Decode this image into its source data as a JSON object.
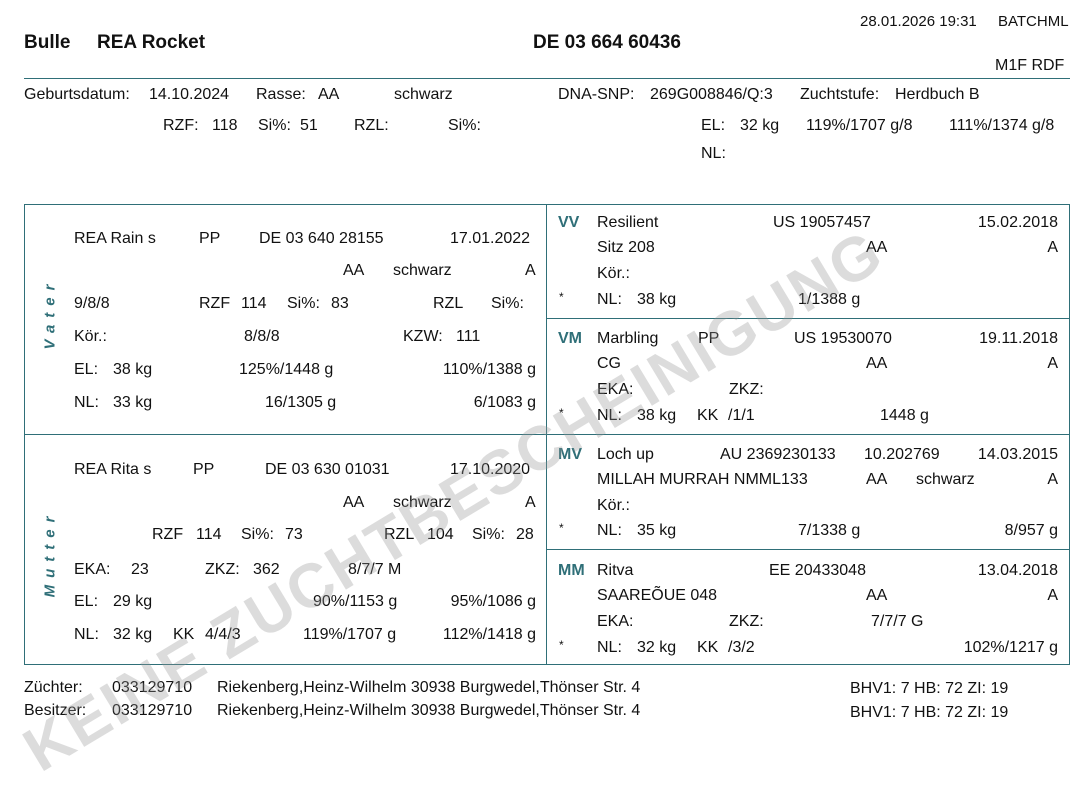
{
  "header": {
    "datetime": "28.01.2026 19:31",
    "user": "BATCHML",
    "sex": "Bulle",
    "name": "REA Rocket",
    "id": "DE 03 664 60436",
    "code": "M1F RDF"
  },
  "animal": {
    "birth_label": "Geburtsdatum:",
    "birth": "14.10.2024",
    "breed_label": "Rasse:",
    "breed": "AA",
    "color": "schwarz",
    "dna_label": "DNA-SNP:",
    "dna": "269G008846/Q:3",
    "level_label": "Zuchtstufe:",
    "level": "Herdbuch B",
    "rzf_label": "RZF:",
    "rzf": "118",
    "si1_label": "Si%:",
    "si1": "51",
    "rzl_label": "RZL:",
    "si2_label": "Si%:",
    "el_label": "EL:",
    "el": "32 kg",
    "el_a": "119%/1707 g/8",
    "el_b": "111%/1374 g/8",
    "nl_label": "NL:"
  },
  "vater": {
    "side_label": "Vater",
    "name": "REA Rain s",
    "polled": "PP",
    "id": "DE 03 640 28155",
    "date": "17.01.2022",
    "breed": "AA",
    "color": "schwarz",
    "grade": "A",
    "score": "9/8/8",
    "rzf_label": "RZF",
    "rzf": "114",
    "si1_label": "Si%:",
    "si1": "83",
    "rzl_label": "RZL",
    "si2_label": "Si%:",
    "kor_label": "Kör.:",
    "kor": "8/8/8",
    "kzw_label": "KZW:",
    "kzw": "111",
    "el_label": "EL:",
    "el": "38 kg",
    "el_a": "125%/1448 g",
    "el_b": "110%/1388 g",
    "nl_label": "NL:",
    "nl": "33 kg",
    "nl_a": "16/1305 g",
    "nl_b": "6/1083 g"
  },
  "mutter": {
    "side_label": "Mutter",
    "name": "REA Rita s",
    "polled": "PP",
    "id": "DE 03 630 01031",
    "date": "17.10.2020",
    "breed": "AA",
    "color": "schwarz",
    "grade": "A",
    "rzf_label": "RZF",
    "rzf": "114",
    "si1_label": "Si%:",
    "si1": "73",
    "rzl_label": "RZL",
    "rzl": "104",
    "si2_label": "Si%:",
    "si2": "28",
    "eka_label": "EKA:",
    "eka": "23",
    "zkz_label": "ZKZ:",
    "zkz": "362",
    "score": "8/7/7 M",
    "el_label": "EL:",
    "el": "29 kg",
    "el_a": "90%/1153 g",
    "el_b": "95%/1086 g",
    "nl_label": "NL:",
    "nl": "32 kg",
    "kk_label": "KK",
    "kk": "4/4/3",
    "nl_a": "119%/1707 g",
    "nl_b": "112%/1418 g"
  },
  "vv": {
    "code": "VV",
    "name": "Resilient",
    "id": "US 19057457",
    "date": "15.02.2018",
    "line2": "Sitz 208",
    "breed": "AA",
    "grade": "A",
    "kor_label": "Kör.:",
    "star": "*",
    "nl_label": "NL:",
    "nl": "38 kg",
    "nl_a": "1/1388 g"
  },
  "vm": {
    "code": "VM",
    "name": "Marbling",
    "polled": "PP",
    "id": "US 19530070",
    "date": "19.11.2018",
    "line2": "CG",
    "breed": "AA",
    "grade": "A",
    "eka_label": "EKA:",
    "zkz_label": "ZKZ:",
    "star": "*",
    "nl_label": "NL:",
    "nl": "38 kg",
    "kk_label": "KK",
    "kk": "/1/1",
    "nl_a": "1448 g"
  },
  "mv": {
    "code": "MV",
    "name": "Loch up",
    "id": "AU 2369230133",
    "id2": "10.202769",
    "date": "14.03.2015",
    "line2": "MILLAH MURRAH NMML133",
    "breed": "AA",
    "color": "schwarz",
    "grade": "A",
    "kor_label": "Kör.:",
    "star": "*",
    "nl_label": "NL:",
    "nl": "35 kg",
    "nl_a": "7/1338 g",
    "nl_b": "8/957 g"
  },
  "mm": {
    "code": "MM",
    "name": "Ritva",
    "id": "EE 20433048",
    "date": "13.04.2018",
    "line2": "SAAREÕUE 048",
    "breed": "AA",
    "grade": "A",
    "eka_label": "EKA:",
    "zkz_label": "ZKZ:",
    "score": "7/7/7 G",
    "star": "*",
    "nl_label": "NL:",
    "nl": "32 kg",
    "kk_label": "KK",
    "kk": "/3/2",
    "nl_a": "102%/1217 g"
  },
  "footer": {
    "breeder_label": "Züchter:",
    "breeder_nr": "033129710",
    "breeder": "Riekenberg,Heinz-Wilhelm 30938 Burgwedel,Thönser Str. 4",
    "owner_label": "Besitzer:",
    "owner_nr": "033129710",
    "owner": "Riekenberg,Heinz-Wilhelm 30938 Burgwedel,Thönser Str. 4",
    "health1": "BHV1: 7  HB: 72  ZI: 19",
    "health2": "BHV1: 7  HB: 72  ZI: 19"
  },
  "watermark": "KEINE ZUCHTBESCHEINIGUNG"
}
